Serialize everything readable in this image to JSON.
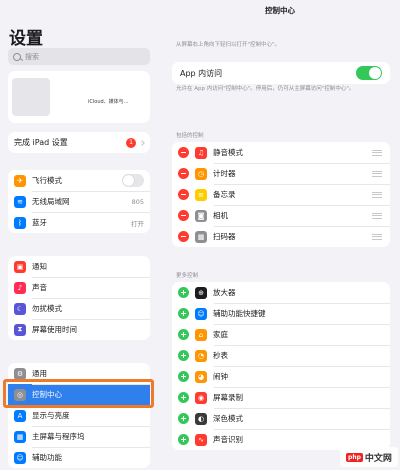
{
  "sidebar": {
    "title": "设置",
    "search_placeholder": "搜索",
    "profile_text": "iCloud、媒体与...",
    "setup": {
      "label": "完成 iPad 设置",
      "badge": "1"
    },
    "group1": [
      {
        "label": "飞行模式",
        "icon": "airplane-icon",
        "color": "#ff9500",
        "glyph": "✈",
        "value": ""
      },
      {
        "label": "无线局域网",
        "icon": "wifi-icon",
        "color": "#007aff",
        "glyph": "≋",
        "value": "805"
      },
      {
        "label": "蓝牙",
        "icon": "bluetooth-icon",
        "color": "#007aff",
        "glyph": "ᛒ",
        "value": "打开"
      }
    ],
    "group2": [
      {
        "label": "通知",
        "icon": "notification-icon",
        "color": "#ff3b30",
        "glyph": "▣"
      },
      {
        "label": "声音",
        "icon": "sound-icon",
        "color": "#ff2d55",
        "glyph": "♪"
      },
      {
        "label": "勿扰模式",
        "icon": "moon-icon",
        "color": "#5856d6",
        "glyph": "☾"
      },
      {
        "label": "屏幕使用时间",
        "icon": "hourglass-icon",
        "color": "#5856d6",
        "glyph": "⧗"
      }
    ],
    "group3": [
      {
        "label": "通用",
        "icon": "gear-icon",
        "color": "#8e8e93",
        "glyph": "⚙"
      },
      {
        "label": "控制中心",
        "icon": "control-center-icon",
        "color": "#8e8e93",
        "glyph": "◎"
      },
      {
        "label": "显示与亮度",
        "icon": "display-icon",
        "color": "#007aff",
        "glyph": "A"
      },
      {
        "label": "主屏幕与程序坞",
        "icon": "home-screen-icon",
        "color": "#007aff",
        "glyph": "▦"
      },
      {
        "label": "辅助功能",
        "icon": "accessibility-icon",
        "color": "#007aff",
        "glyph": "☺"
      }
    ]
  },
  "detail": {
    "title": "控制中心",
    "note1": "从屏幕右上角向下轻扫以打开\"控制中心\"。",
    "app_access": {
      "label": "App 内访问"
    },
    "note2": "允许在 App 内访问\"控制中心\"。停用后，仍可从主屏幕访问\"控制中心\"。",
    "included_header": "包括的控制",
    "included": [
      {
        "label": "静音模式",
        "icon": "bell-icon",
        "color": "#ff3b30",
        "glyph": "🔔"
      },
      {
        "label": "计时器",
        "icon": "timer-icon",
        "color": "#ff9500",
        "glyph": "◷"
      },
      {
        "label": "备忘录",
        "icon": "notes-icon",
        "color": "#ffcc00",
        "glyph": "≡"
      },
      {
        "label": "相机",
        "icon": "camera-icon",
        "color": "#8e8e93",
        "glyph": "◙"
      },
      {
        "label": "扫码器",
        "icon": "qr-scanner-icon",
        "color": "#8e8e93",
        "glyph": "▩"
      }
    ],
    "more_header": "更多控制",
    "more": [
      {
        "label": "放大器",
        "icon": "magnifier-icon",
        "color": "#1c1c1e",
        "glyph": "⊕"
      },
      {
        "label": "辅助功能快捷键",
        "icon": "accessibility-shortcut-icon",
        "color": "#007aff",
        "glyph": "☺"
      },
      {
        "label": "家庭",
        "icon": "home-icon",
        "color": "#ff9500",
        "glyph": "⌂"
      },
      {
        "label": "秒表",
        "icon": "stopwatch-icon",
        "color": "#ff9500",
        "glyph": "◔"
      },
      {
        "label": "闹钟",
        "icon": "alarm-icon",
        "color": "#ff9500",
        "glyph": "⏰"
      },
      {
        "label": "屏幕录制",
        "icon": "screen-record-icon",
        "color": "#ff3b30",
        "glyph": "◉"
      },
      {
        "label": "深色模式",
        "icon": "dark-mode-icon",
        "color": "#3a3a3c",
        "glyph": "◐"
      },
      {
        "label": "声音识别",
        "icon": "sound-recognition-icon",
        "color": "#ff3b30",
        "glyph": "∿"
      }
    ]
  },
  "watermark": {
    "badge": "php",
    "text": "中文网"
  }
}
